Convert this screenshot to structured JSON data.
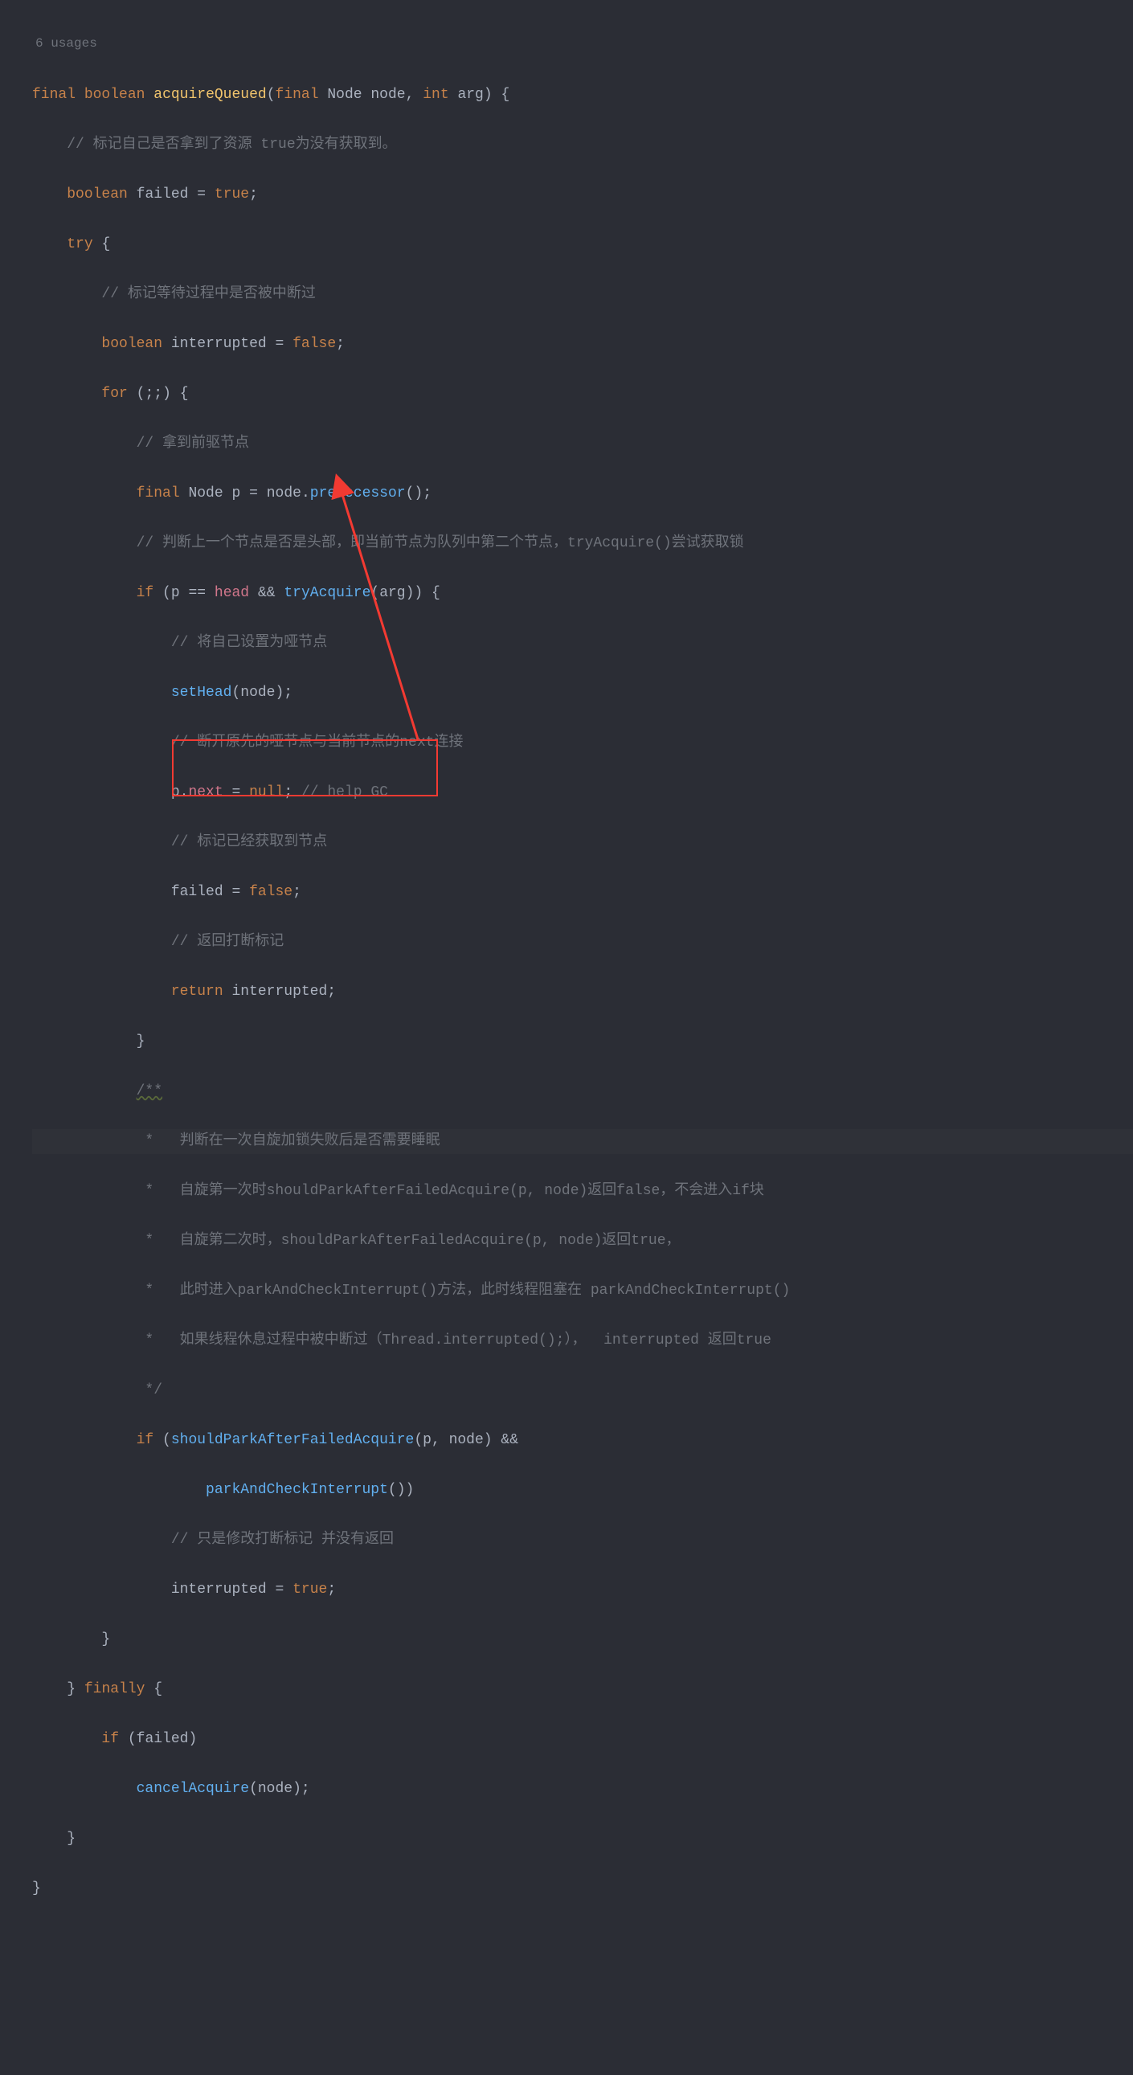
{
  "usages": "6 usages",
  "code": {
    "l1_final": "final",
    "l1_boolean": "boolean",
    "l1_method": "acquireQueued",
    "l1_finalp": "final",
    "l1_Node": "Node",
    "l1_node": "node",
    "l1_int": "int",
    "l1_arg": "arg",
    "l2_comment": "// 标记自己是否拿到了资源 true为没有获取到。",
    "l3_boolean": "boolean",
    "l3_var": "failed",
    "l3_true": "true",
    "l4_try": "try",
    "l5_comment": "// 标记等待过程中是否被中断过",
    "l6_boolean": "boolean",
    "l6_var": "interrupted",
    "l6_false": "false",
    "l7_for": "for",
    "l8_comment": "// 拿到前驱节点",
    "l9_final": "final",
    "l9_Node": "Node",
    "l9_p": "p",
    "l9_node": "node",
    "l9_pred": "predecessor",
    "l10_comment": "// 判断上一个节点是否是头部，即当前节点为队列中第二个节点，tryAcquire()尝试获取锁",
    "l11_if": "if",
    "l11_p": "p",
    "l11_head": "head",
    "l11_tryAcquire": "tryAcquire",
    "l11_arg": "arg",
    "l12_comment": "// 将自己设置为哑节点",
    "l13_setHead": "setHead",
    "l13_node": "node",
    "l14_comment": "// 断开原先的哑节点与当前节点的next连接",
    "l15_p": "p",
    "l15_next": "next",
    "l15_null": "null",
    "l15_comment": "// help GC",
    "l16_comment": "// 标记已经获取到节点",
    "l17_failed": "failed",
    "l17_false": "false",
    "l18_comment": "// 返回打断标记",
    "l19_return": "return",
    "l19_interrupted": "interrupted",
    "l21_doc": "/**",
    "l22_doc": " *   判断在一次自旋加锁失败后是否需要睡眠",
    "l23_doc": " *   自旋第一次时shouldParkAfterFailedAcquire(p, node)返回false，不会进入if块",
    "l24_doc": " *   自旋第二次时，shouldParkAfterFailedAcquire(p, node)返回true，",
    "l25_doc": " *   此时进入parkAndCheckInterrupt()方法，此时线程阻塞在 parkAndCheckInterrupt()",
    "l26_doc": " *   如果线程休息过程中被中断过（Thread.interrupted();），  interrupted 返回true",
    "l27_doc": " */",
    "l28_if": "if",
    "l28_spafa": "shouldParkAfterFailedAcquire",
    "l28_p": "p",
    "l28_node": "node",
    "l29_paci": "parkAndCheckInterrupt",
    "l30_comment": "// 只是修改打断标记 并没有返回",
    "l31_interrupted": "interrupted",
    "l31_true": "true",
    "l33_finally": "finally",
    "l34_if": "if",
    "l34_failed": "failed",
    "l35_cancel": "cancelAcquire",
    "l35_node": "node"
  }
}
